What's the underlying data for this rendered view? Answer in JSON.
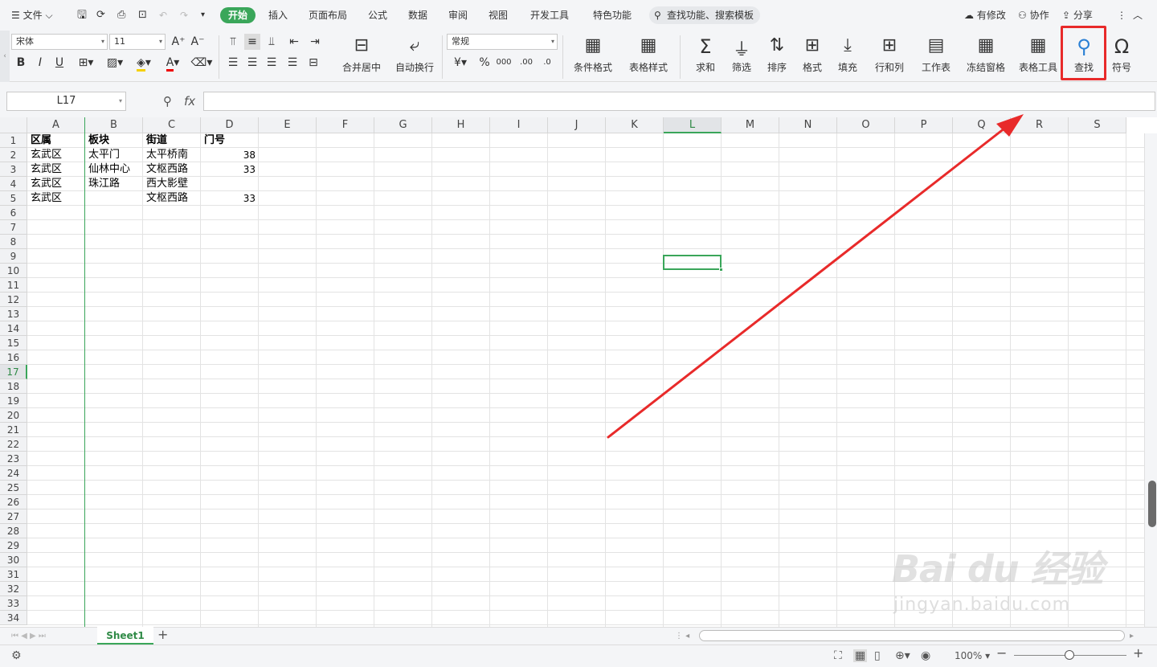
{
  "menubar": {
    "file": "文件",
    "tabs": [
      "开始",
      "插入",
      "页面布局",
      "公式",
      "数据",
      "审阅",
      "视图",
      "开发工具",
      "特色功能"
    ],
    "search_placeholder": "查找功能、搜索模板",
    "modified": "有修改",
    "collab": "协作",
    "share": "分享"
  },
  "ribbon": {
    "font_name": "宋体",
    "font_size": "11",
    "number_format": "常规",
    "merge_center": "合并居中",
    "auto_wrap": "自动换行",
    "cond_format": "条件格式",
    "table_style": "表格样式",
    "sum": "求和",
    "filter": "筛选",
    "sort": "排序",
    "format": "格式",
    "fill": "填充",
    "rowcol": "行和列",
    "worksheet": "工作表",
    "freeze": "冻结窗格",
    "table_tools": "表格工具",
    "find": "查找",
    "symbol": "符号"
  },
  "formula_bar": {
    "name_box": "L17",
    "fx": "fx",
    "value": ""
  },
  "columns": [
    "A",
    "B",
    "C",
    "D",
    "E",
    "F",
    "G",
    "H",
    "I",
    "J",
    "K",
    "L",
    "M",
    "N",
    "O",
    "P",
    "Q",
    "R",
    "S"
  ],
  "selected_column": "L",
  "selected_row": "17",
  "rows": [
    "1",
    "2",
    "3",
    "4",
    "5",
    "6",
    "7",
    "8",
    "9",
    "10",
    "11",
    "12",
    "13",
    "14",
    "15",
    "16",
    "17",
    "18",
    "19",
    "20",
    "21",
    "22",
    "23",
    "24",
    "25",
    "26",
    "27",
    "28",
    "29",
    "30",
    "31",
    "32",
    "33",
    "34"
  ],
  "sheet": {
    "headers": [
      "区属",
      "板块",
      "街道",
      "门号"
    ],
    "data": [
      [
        "玄武区",
        "太平门",
        "太平桥南",
        "38"
      ],
      [
        "玄武区",
        "仙林中心",
        "文枢西路",
        "33"
      ],
      [
        "玄武区",
        "珠江路",
        "西大影壁",
        ""
      ],
      [
        "玄武区",
        "",
        "文枢西路",
        "33"
      ]
    ]
  },
  "sheet_tab": "Sheet1",
  "status": {
    "zoom": "100%"
  },
  "watermark": {
    "main": "Bai du 经验",
    "sub": "jingyan.baidu.com"
  },
  "colors": {
    "accent": "#3aa65a",
    "annotation": "#e82a2a"
  }
}
